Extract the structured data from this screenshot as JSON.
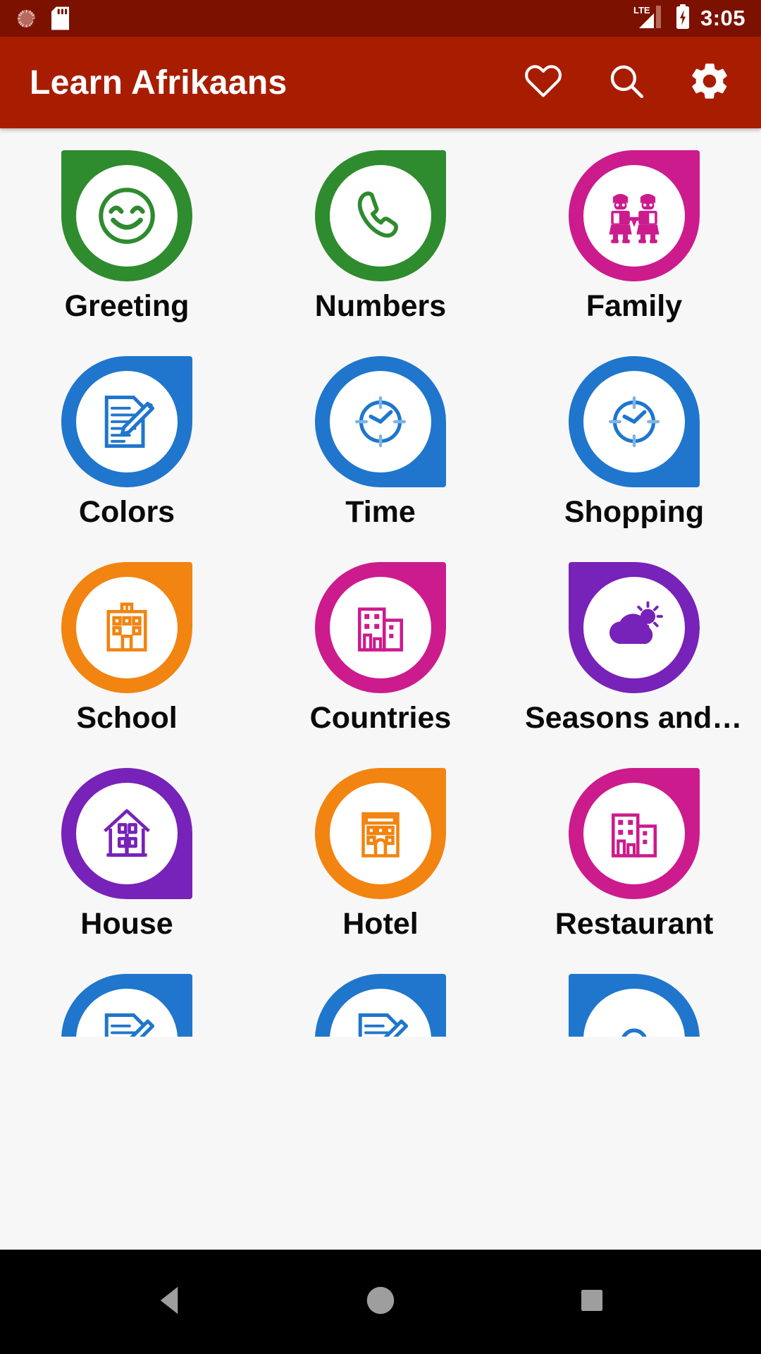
{
  "status_bar": {
    "background": "#7c1100",
    "time": "3:05",
    "network_type": "LTE",
    "icons": [
      "alarm-dial-icon",
      "sd-card-icon",
      "lte-signal-icon",
      "battery-charging-icon"
    ]
  },
  "app_bar": {
    "background": "#a81d00",
    "title": "Learn Afrikaans",
    "actions": [
      {
        "name": "favorites-button",
        "icon": "heart-icon",
        "label": "Favorites"
      },
      {
        "name": "search-button",
        "icon": "search-icon",
        "label": "Search"
      },
      {
        "name": "settings-button",
        "icon": "gear-icon",
        "label": "Settings"
      }
    ]
  },
  "grid": {
    "columns": 3,
    "tiles": [
      {
        "label": "Greeting",
        "color": "#2e8b2e",
        "icon": "smiley-face-icon",
        "corner": "c-tl"
      },
      {
        "label": "Numbers",
        "color": "#2e8b2e",
        "icon": "phone-handset-icon",
        "corner": "c-tr"
      },
      {
        "label": "Family",
        "color": "#cc1b8d",
        "icon": "family-people-icon",
        "corner": "c-tr"
      },
      {
        "label": "Colors",
        "color": "#1f76cc",
        "icon": "document-pencil-icon",
        "corner": "c-tr"
      },
      {
        "label": "Time",
        "color": "#1f76cc",
        "icon": "clock-icon",
        "corner": "c-br"
      },
      {
        "label": "Shopping",
        "color": "#1f76cc",
        "icon": "clock-icon",
        "corner": "c-br"
      },
      {
        "label": "School",
        "color": "#f28411",
        "icon": "school-building-icon",
        "corner": "c-tr"
      },
      {
        "label": "Countries",
        "color": "#cc1b8d",
        "icon": "city-buildings-icon",
        "corner": "c-tr"
      },
      {
        "label": "Seasons and Weather",
        "color": "#7722b8",
        "icon": "cloud-sun-icon",
        "corner": "c-tl"
      },
      {
        "label": "House",
        "color": "#7722b8",
        "icon": "house-icon",
        "corner": "c-br"
      },
      {
        "label": "Hotel",
        "color": "#f28411",
        "icon": "hotel-building-icon",
        "corner": "c-tr"
      },
      {
        "label": "Restaurant",
        "color": "#cc1b8d",
        "icon": "city-buildings-icon",
        "corner": "c-tr"
      },
      {
        "label": "",
        "color": "#1f76cc",
        "icon": "document-pencil-icon",
        "corner": "c-tr"
      },
      {
        "label": "",
        "color": "#1f76cc",
        "icon": "document-pencil-icon",
        "corner": "c-tr"
      },
      {
        "label": "",
        "color": "#1f76cc",
        "icon": "arch-icon",
        "corner": "c-tl"
      }
    ]
  },
  "nav_bar": {
    "background": "#000000",
    "buttons": [
      {
        "name": "back-button",
        "icon": "triangle-back-icon"
      },
      {
        "name": "home-button",
        "icon": "circle-home-icon"
      },
      {
        "name": "recents-button",
        "icon": "square-recents-icon"
      }
    ]
  }
}
